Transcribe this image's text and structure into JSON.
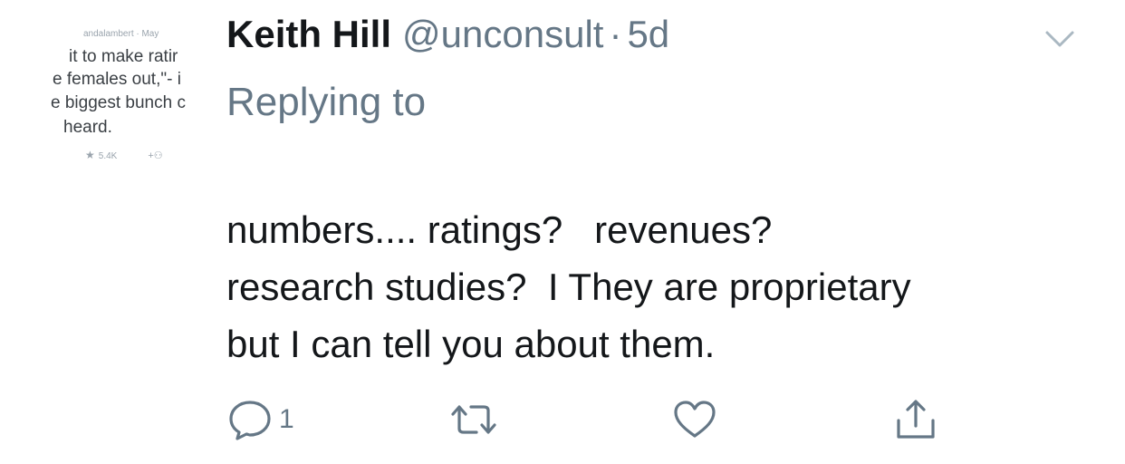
{
  "avatar": {
    "meta": "andalambert · May",
    "lines": [
      "it to make ratir",
      "e females out,\"- i",
      "e biggest bunch c",
      "heard."
    ],
    "like_count": "5.4K"
  },
  "tweet": {
    "author_name": "Keith Hill",
    "handle": "@unconsult",
    "separator": "·",
    "time": "5d",
    "replying_to": "Replying to",
    "body_lines": [
      "numbers.... ratings?   revenues?",
      "research studies?  I They are proprietary",
      "but I can tell you about them."
    ]
  },
  "actions": {
    "reply_count": "1"
  },
  "icons": {
    "menu": "chevron-down-icon",
    "reply": "reply-icon",
    "retweet": "retweet-icon",
    "like": "heart-icon",
    "share": "share-icon"
  },
  "colors": {
    "text": "#14171a",
    "secondary": "#657786",
    "icon": "#657786"
  }
}
